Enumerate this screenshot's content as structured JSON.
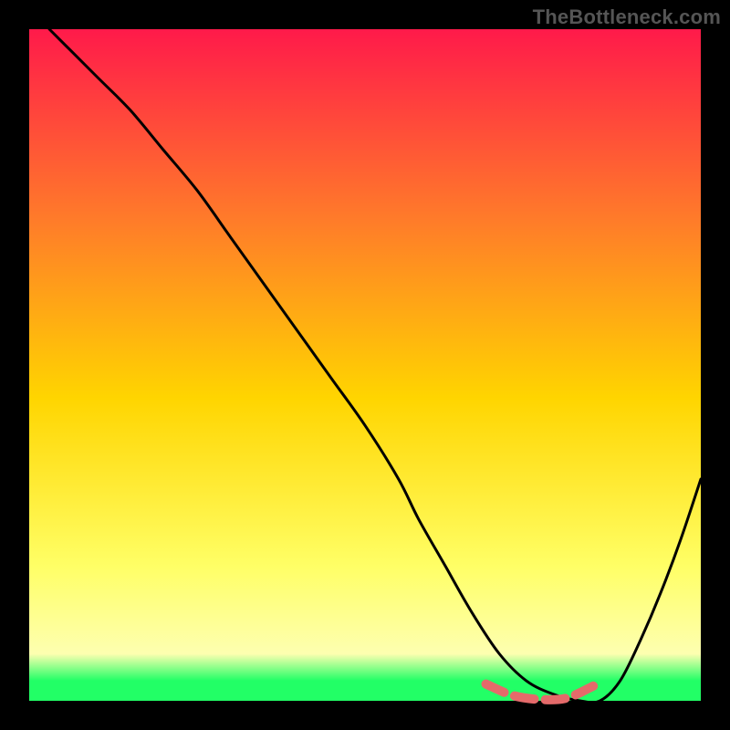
{
  "watermark": "TheBottleneck.com",
  "colors": {
    "gradient_top": "#ff1a4a",
    "gradient_mid_upper": "#ff7a2a",
    "gradient_mid": "#ffd500",
    "gradient_lower": "#ffff66",
    "gradient_bottom_yellow": "#fdffb0",
    "gradient_bottom_green": "#22ff66",
    "curve_stroke": "#000000",
    "highlight_stroke": "#e46a6a",
    "frame": "#000000"
  },
  "chart_data": {
    "type": "line",
    "title": "",
    "xlabel": "",
    "ylabel": "",
    "xlim": [
      0,
      100
    ],
    "ylim": [
      0,
      100
    ],
    "series": [
      {
        "name": "bottleneck-curve",
        "x": [
          3,
          6,
          10,
          15,
          20,
          25,
          30,
          35,
          40,
          45,
          50,
          55,
          58,
          62,
          66,
          70,
          74,
          78,
          82,
          85,
          88,
          91,
          94,
          97,
          100
        ],
        "values": [
          100,
          97,
          93,
          88,
          82,
          76,
          69,
          62,
          55,
          48,
          41,
          33,
          27,
          20,
          13,
          7,
          3,
          1,
          0,
          0,
          3,
          9,
          16,
          24,
          33
        ]
      },
      {
        "name": "minimum-highlight",
        "x": [
          68,
          72,
          76,
          80,
          84
        ],
        "values": [
          2.5,
          0.8,
          0.2,
          0.4,
          2.2
        ]
      }
    ],
    "annotations": []
  }
}
